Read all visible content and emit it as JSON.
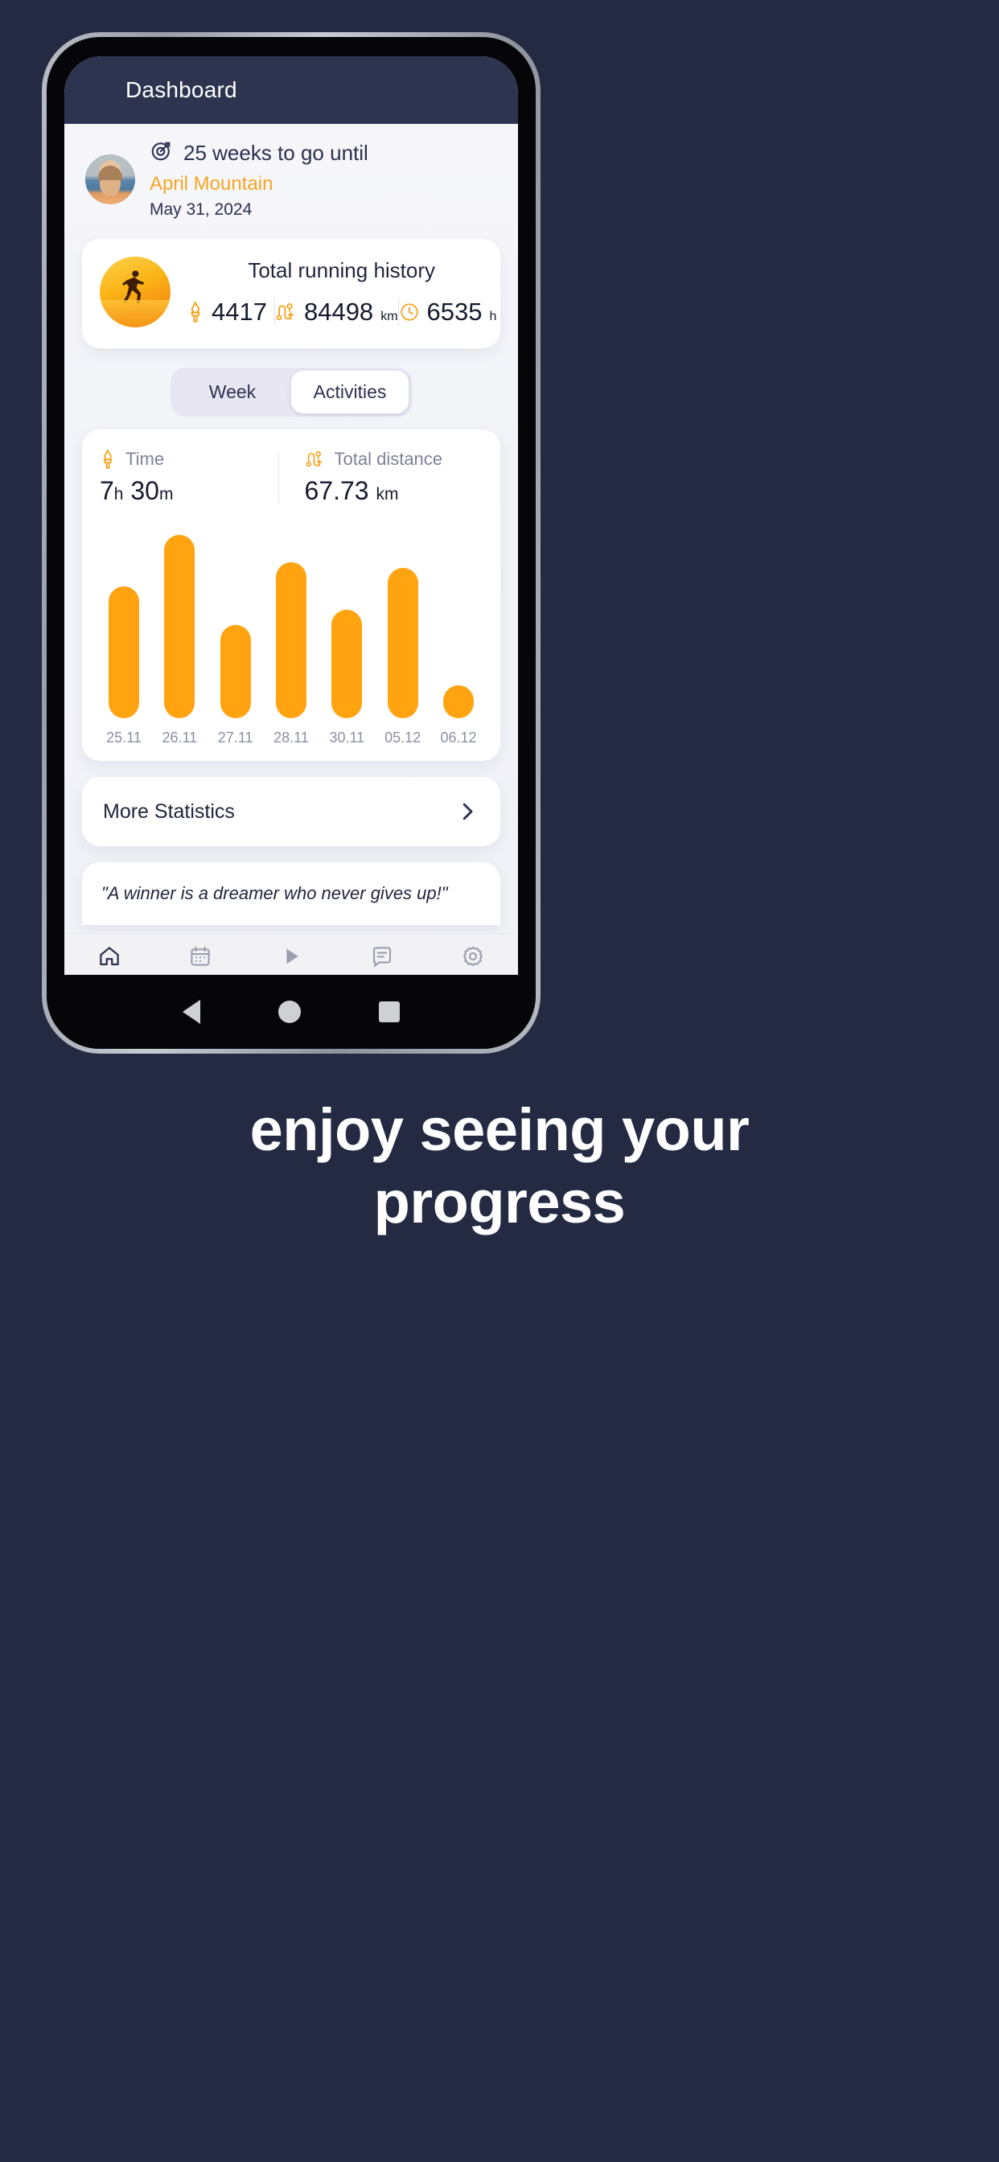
{
  "appbar": {
    "title": "Dashboard"
  },
  "goal": {
    "icon": "target-arrow-icon",
    "countdown": "25 weeks to go until",
    "event_name": "April Mountain",
    "event_date": "May 31, 2024",
    "accent_color": "#f5a623"
  },
  "history": {
    "title": "Total running history",
    "photo": "runner-sunset-photo",
    "stats": [
      {
        "icon": "torch-icon",
        "value": "4417",
        "unit": ""
      },
      {
        "icon": "route-icon",
        "value": "84498",
        "unit": "km"
      },
      {
        "icon": "clock-icon",
        "value": "6535",
        "unit": "h"
      }
    ]
  },
  "segment": {
    "options": [
      "Week",
      "Activities"
    ],
    "selected": "Activities"
  },
  "summary": {
    "time": {
      "icon": "torch-icon",
      "label": "Time",
      "value": "7",
      "unit1": "h",
      "value2": "30",
      "unit2": "m"
    },
    "distance": {
      "icon": "route-icon",
      "label": "Total distance",
      "value": "67.73",
      "unit": "km"
    }
  },
  "chart_data": {
    "type": "bar",
    "title": "",
    "categories": [
      "25.11",
      "26.11",
      "27.11",
      "28.11",
      "30.11",
      "05.12",
      "06.12"
    ],
    "values": [
      72,
      100,
      51,
      85,
      59,
      82,
      18
    ],
    "xlabel": "",
    "ylabel": "",
    "ylim": [
      0,
      100
    ],
    "grid": false,
    "legend": "none",
    "bar_color": "#ffa410"
  },
  "more_statistics": {
    "label": "More Statistics",
    "icon": "chevron-right-icon"
  },
  "quote": {
    "text": "\"A winner is a dreamer who never gives up!\""
  },
  "bottom_nav": {
    "items": [
      {
        "label": "Dashboard",
        "icon": "home-icon",
        "active": true
      },
      {
        "label": "Calendar",
        "icon": "calendar-icon",
        "active": false
      },
      {
        "label": "Track",
        "icon": "play-icon",
        "active": false
      },
      {
        "label": "Chat",
        "icon": "chat-icon",
        "active": false
      },
      {
        "label": "Settings",
        "icon": "gear-icon",
        "active": false
      }
    ]
  },
  "system_bar": {
    "back": "back-triangle-icon",
    "home": "home-circle-icon",
    "recents": "recents-square-icon"
  },
  "caption": {
    "line1": "enjoy seeing your",
    "line2": "progress"
  }
}
